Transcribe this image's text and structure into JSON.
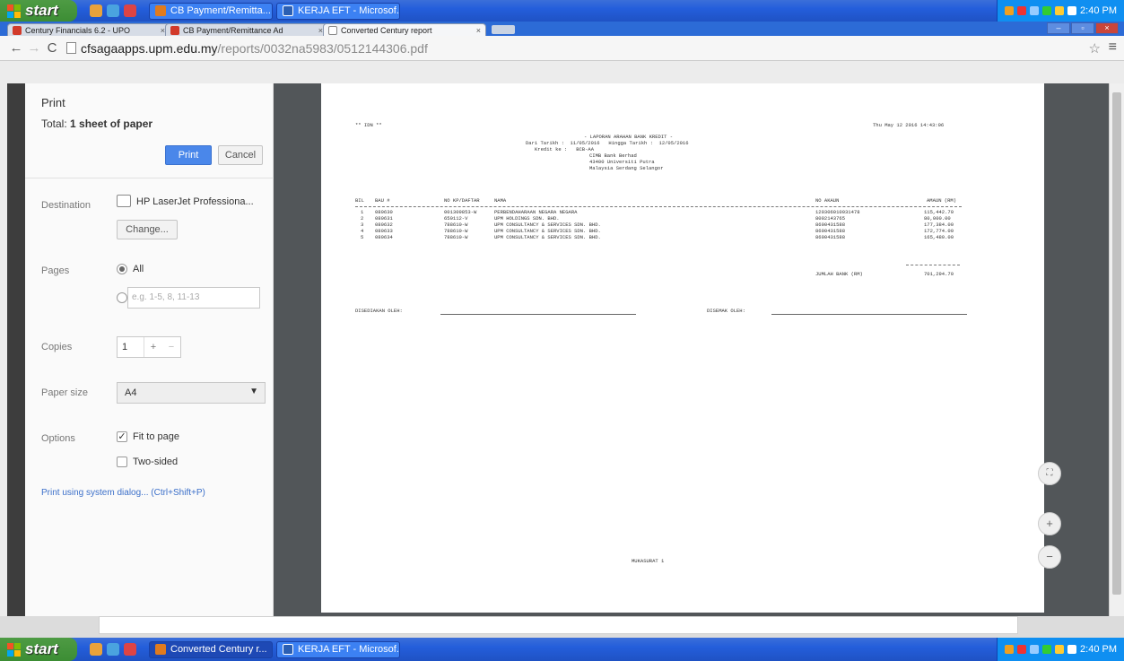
{
  "taskbar_top": {
    "start_label": "start",
    "tasks": [
      {
        "label": "CB Payment/Remitta...",
        "icon_color": "#e07b1e"
      },
      {
        "label": "KERJA EFT - Microsof...",
        "icon_color": "#2b5fb3"
      }
    ],
    "clock": "2:40 PM"
  },
  "tabs": [
    {
      "label": "Century Financials 6.2 - UPO",
      "icon_color": "#d23a2a"
    },
    {
      "label": "CB Payment/Remittance Ad",
      "icon_color": "#d23a2a"
    },
    {
      "label": "Converted Century report",
      "icon_color": "#ffffff"
    }
  ],
  "address": {
    "host": "cfsagaapps.upm.edu.my",
    "path": "/reports/0032na5983/0512144306.pdf"
  },
  "print_panel": {
    "title": "Print",
    "total_prefix": "Total: ",
    "total_value": "1 sheet of paper",
    "print_btn": "Print",
    "cancel_btn": "Cancel",
    "destination_label": "Destination",
    "destination_name": "HP LaserJet Professiona...",
    "change_btn": "Change...",
    "pages_label": "Pages",
    "pages_all": "All",
    "pages_placeholder": "e.g. 1-5, 8, 11-13",
    "copies_label": "Copies",
    "copies_value": "1",
    "copies_plus": "+",
    "copies_minus": "−",
    "paper_label": "Paper size",
    "paper_value": "A4",
    "options_label": "Options",
    "fit_label": "Fit to page",
    "fit_checked": true,
    "two_sided_label": "Two-sided",
    "system_dialog": "Print using system dialog... (Ctrl+Shift+P)"
  },
  "report": {
    "top_left": "** IDN **",
    "top_right": "Thu May 12 2016 14:43:06",
    "heading": "- LAPORAN ARAHAN BANK KREDIT -",
    "dari_line": "Dari Tarikh :  11/05/2016   Hingga Tarikh :  12/05/2016",
    "kredit_line": "Kredit ke :   BCB-AA",
    "addr1": "CIMB Bank Berhad",
    "addr2": "43400 Universiti Putra",
    "addr3": "Malaysia Serdang Selangor",
    "col_bil": "BIL",
    "col_bau": "BAU #",
    "col_nokp": "NO KP/DAFTAR",
    "col_nama": "NAMA",
    "col_akaun": "NO AKAUN",
    "col_amaun": "AMAUN (RM)",
    "rows": [
      {
        "bil": "1",
        "bau": "080630",
        "kp": "001309853-W",
        "nama": "PERBENDAHARAAN NEGARA NEGARA",
        "akaun": "120306010031478",
        "amaun": "115,442.70"
      },
      {
        "bil": "2",
        "bau": "080631",
        "kp": "650112-V",
        "nama": "UPM HOLDINGS SDN. BHD.",
        "akaun": "8002143765",
        "amaun": "80,000.00"
      },
      {
        "bil": "3",
        "bau": "080632",
        "kp": "788610-W",
        "nama": "UPM CONSULTANCY & SERVICES SDN. BHD.",
        "akaun": "8600431588",
        "amaun": "177,384.00"
      },
      {
        "bil": "4",
        "bau": "080633",
        "kp": "788610-W",
        "nama": "UPM CONSULTANCY & SERVICES SDN. BHD.",
        "akaun": "8600431588",
        "amaun": "172,774.00"
      },
      {
        "bil": "5",
        "bau": "080634",
        "kp": "788610-W",
        "nama": "UPM CONSULTANCY & SERVICES SDN. BHD.",
        "akaun": "8600431588",
        "amaun": "165,480.00"
      }
    ],
    "jumlah_label": "JUMLAH BANK (RM)",
    "jumlah_value": "701,294.70",
    "disediakan": "DISEDIAKAN OLEH:",
    "disemak": "DISEMAK OLEH:",
    "footer": "MUKASURAT 1"
  },
  "viewer_controls": {
    "fit": "⛶",
    "zoom_in": "+",
    "zoom_out": "−"
  },
  "taskbar_bottom": {
    "start_label": "start",
    "tasks": [
      {
        "label": "Converted Century r...",
        "icon_color": "#e07b1e"
      },
      {
        "label": "KERJA EFT - Microsof...",
        "icon_color": "#2b5fb3"
      }
    ],
    "clock": "2:40 PM"
  }
}
